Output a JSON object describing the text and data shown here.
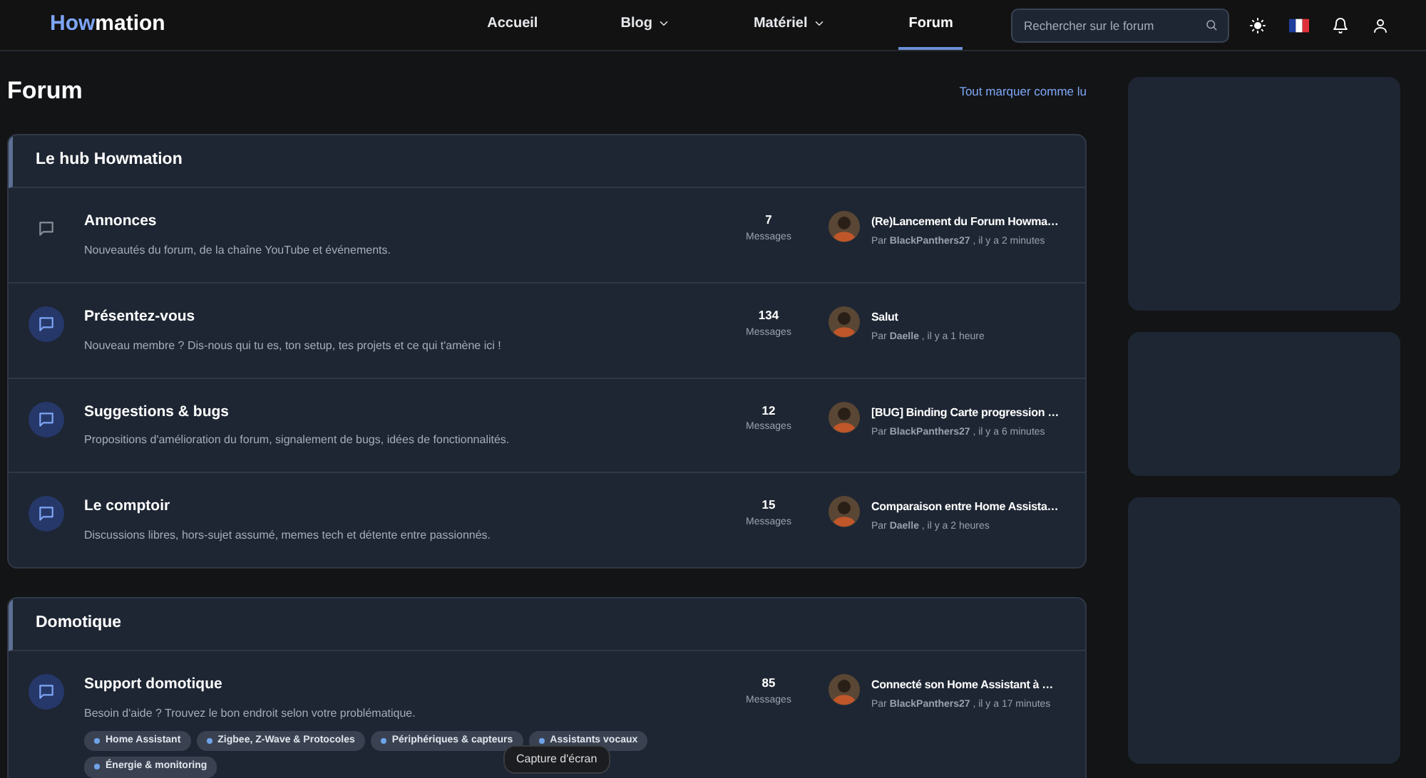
{
  "navbar": {
    "logo": {
      "accent": "How",
      "rest": "mation"
    },
    "links": [
      {
        "label": "Accueil",
        "dropdown": false,
        "selected": false
      },
      {
        "label": "Blog",
        "dropdown": true,
        "selected": false
      },
      {
        "label": "Matériel",
        "dropdown": true,
        "selected": false
      },
      {
        "label": "Forum",
        "dropdown": false,
        "selected": true
      }
    ],
    "search": {
      "placeholder": "Rechercher sur le forum"
    }
  },
  "page": {
    "title": "Forum",
    "mark_all_read": "Tout marquer comme lu"
  },
  "sections": [
    {
      "title": "Le hub Howmation",
      "forums": [
        {
          "title": "Annonces",
          "description": "Nouveautés du forum, de la chaîne YouTube et événements.",
          "unread": false,
          "count": "7",
          "count_label": "Messages",
          "last_post": {
            "title": "(Re)Lancement du Forum Howma…",
            "byline": "Par **BlackPanthers27** , il y a 2 minutes"
          }
        },
        {
          "title": "Présentez-vous",
          "description": "Nouveau membre ? Dis-nous qui tu es, ton setup, tes projets et ce qui t'amène ici !",
          "unread": true,
          "count": "134",
          "count_label": "Messages",
          "last_post": {
            "title": "Salut",
            "byline": "Par **Daelle** , il y a 1 heure"
          }
        },
        {
          "title": "Suggestions & bugs",
          "description": "Propositions d'amélioration du forum, signalement de bugs, idées de fonctionnalités.",
          "unread": true,
          "count": "12",
          "count_label": "Messages",
          "last_post": {
            "title": "[BUG] Binding Carte progression …",
            "byline": "Par **BlackPanthers27** , il y a 6 minutes"
          }
        },
        {
          "title": "Le comptoir",
          "description": "Discussions libres, hors-sujet assumé, memes tech et détente entre passionnés.",
          "unread": true,
          "count": "15",
          "count_label": "Messages",
          "last_post": {
            "title": "Comparaison entre Home Assista…",
            "byline": "Par **Daelle** , il y a 2 heures"
          }
        }
      ]
    },
    {
      "title": "Domotique",
      "forums": [
        {
          "title": "Support domotique",
          "description": "Besoin d'aide ? Trouvez le bon endroit selon votre problématique.",
          "unread": true,
          "count": "85",
          "count_label": "Messages",
          "tags": [
            "Home Assistant",
            "Zigbee, Z-Wave & Protocoles",
            "Périphériques & capteurs",
            "Assistants vocaux",
            "Énergie & monitoring"
          ],
          "last_post": {
            "title": "Connecté son Home Assistant à …",
            "byline": "Par **BlackPanthers27** , il y a 17 minutes"
          }
        }
      ]
    }
  ],
  "tooltip": "Capture d'écran"
}
